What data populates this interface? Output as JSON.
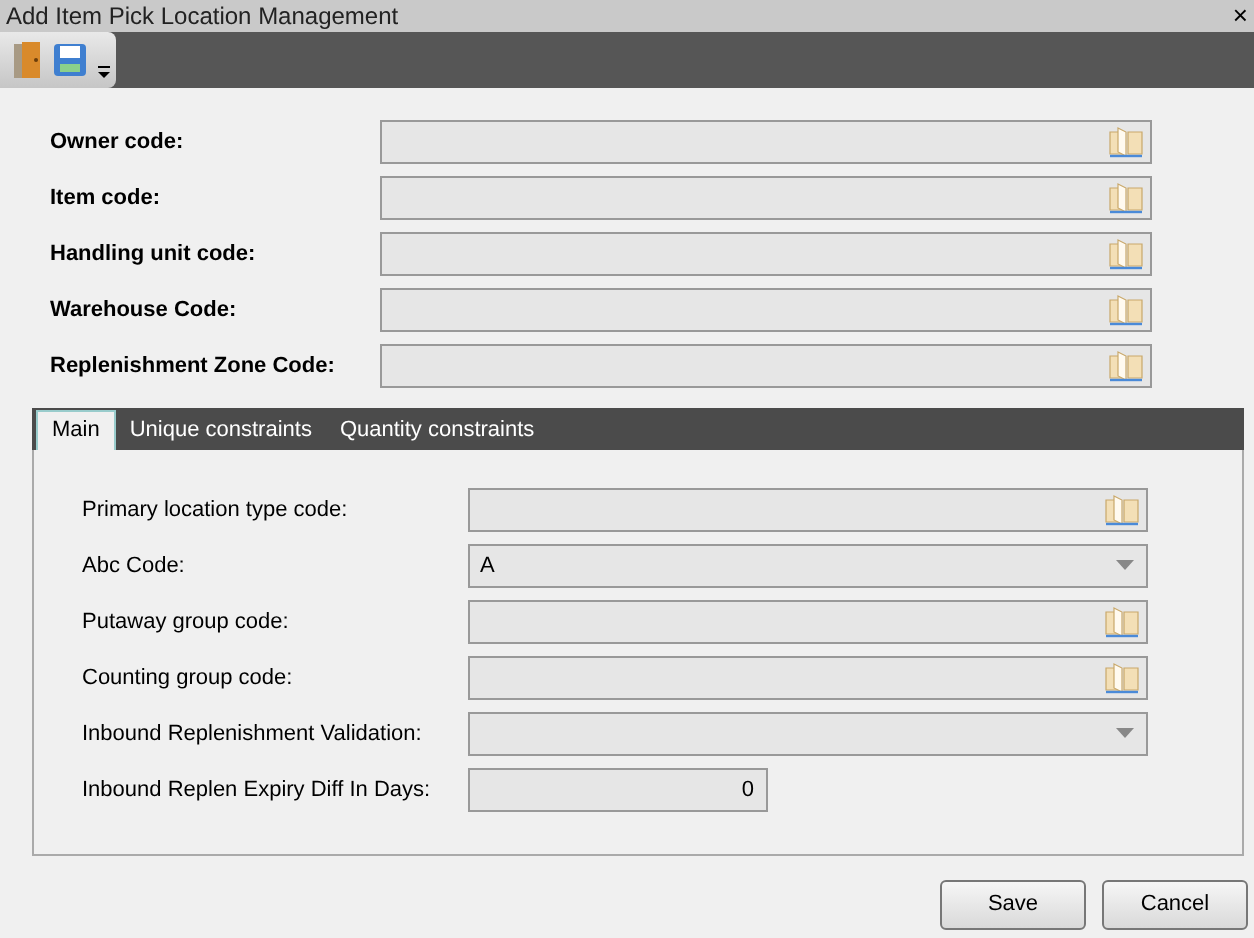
{
  "window": {
    "title": "Add Item Pick Location Management",
    "close": "×"
  },
  "header_fields": [
    {
      "label": "Owner code:",
      "kind": "lookup"
    },
    {
      "label": "Item code:",
      "kind": "lookup"
    },
    {
      "label": "Handling unit code:",
      "kind": "lookup"
    },
    {
      "label": "Warehouse Code:",
      "kind": "lookup"
    },
    {
      "label": "Replenishment Zone Code:",
      "kind": "lookup"
    }
  ],
  "tabs": [
    {
      "label": "Main",
      "selected": true
    },
    {
      "label": "Unique constraints",
      "selected": false
    },
    {
      "label": "Quantity constraints",
      "selected": false
    }
  ],
  "main_fields": [
    {
      "label": "Primary location type code:",
      "kind": "lookup"
    },
    {
      "label": "Abc Code:",
      "kind": "dropdown",
      "value": "A"
    },
    {
      "label": "Putaway group code:",
      "kind": "lookup"
    },
    {
      "label": "Counting group code:",
      "kind": "lookup"
    },
    {
      "label": "Inbound Replenishment Validation:",
      "kind": "dropdown"
    },
    {
      "label": "Inbound Replen Expiry Diff In Days:",
      "kind": "number",
      "value": "0"
    }
  ],
  "buttons": [
    "Save",
    "Cancel"
  ]
}
